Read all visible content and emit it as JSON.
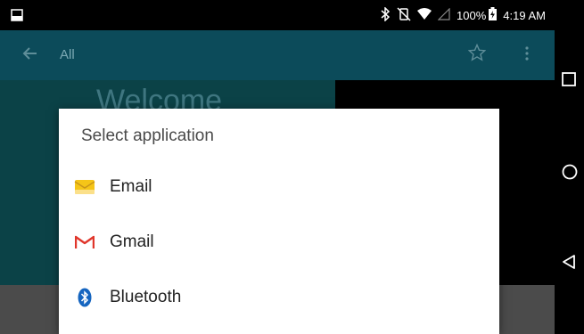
{
  "status_bar": {
    "battery_percent": "100%",
    "time": "4:19 AM",
    "icons": [
      "screenshot-icon",
      "bluetooth-icon",
      "vibrate-icon",
      "wifi-icon",
      "signal-icon",
      "battery-icon"
    ]
  },
  "app_bar": {
    "title": "All",
    "icons": [
      "back-arrow-icon",
      "star-icon",
      "overflow-menu-icon"
    ]
  },
  "background": {
    "welcome_text": "Welcome"
  },
  "dialog": {
    "title": "Select application",
    "items": [
      {
        "label": "Email",
        "icon": "email-icon"
      },
      {
        "label": "Gmail",
        "icon": "gmail-icon"
      },
      {
        "label": "Bluetooth",
        "icon": "bluetooth-share-icon"
      }
    ]
  },
  "nav_bar": {
    "buttons": [
      "recents-button",
      "home-button",
      "back-button"
    ]
  },
  "colors": {
    "app_bar": "#0c4b5a",
    "dialog_bg": "#ffffff",
    "email_icon": "#f5c518",
    "gmail_red": "#e0362b",
    "bluetooth_blue": "#1565c0"
  }
}
